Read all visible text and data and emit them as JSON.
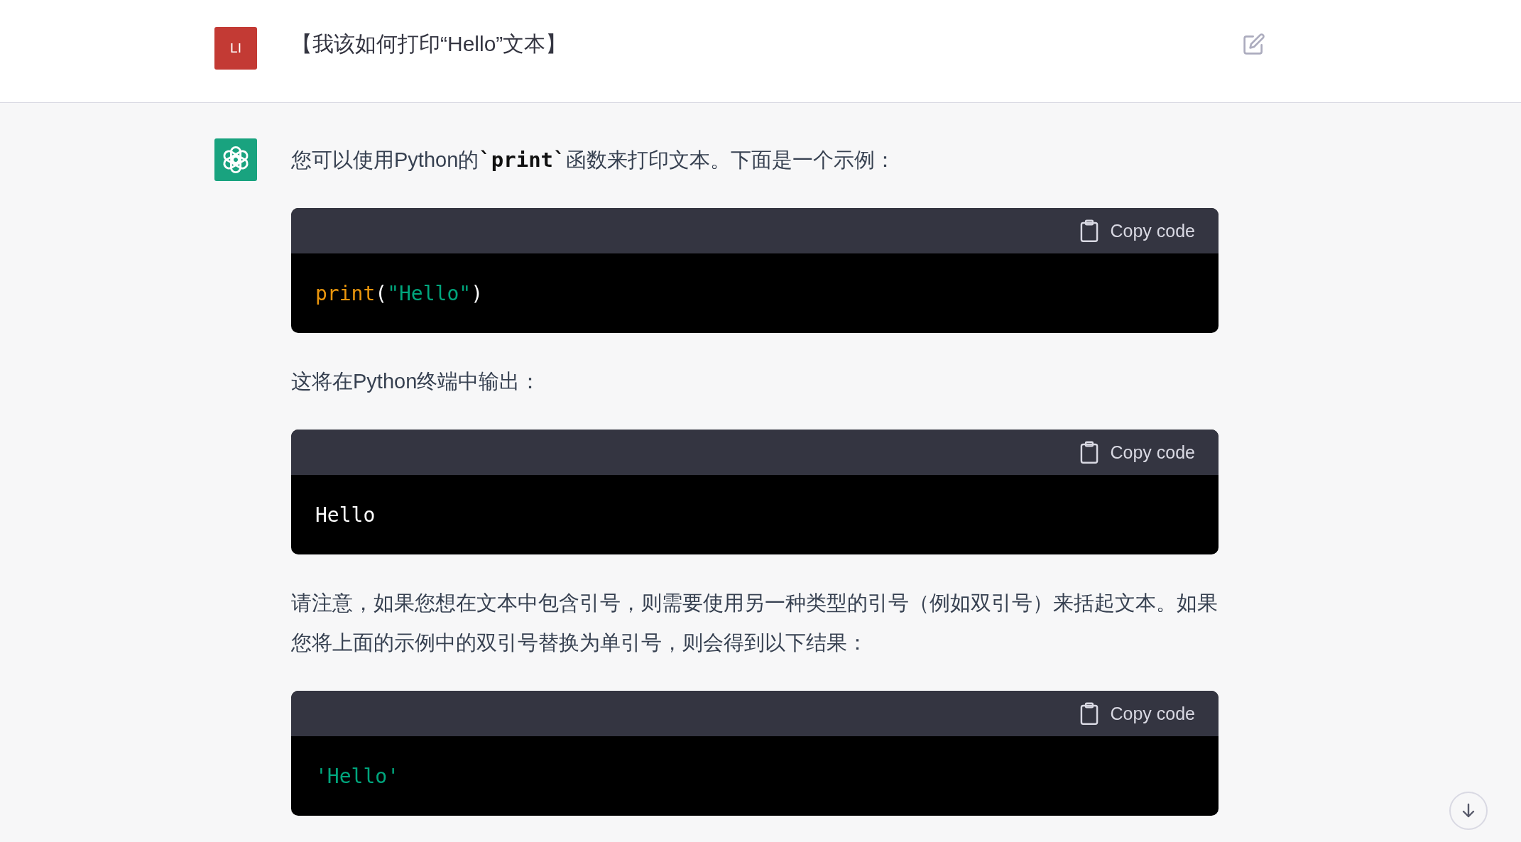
{
  "question": {
    "avatar_text": "LI",
    "text": "【我该如何打印“Hello”文本】"
  },
  "answer": {
    "blocks": [
      {
        "kind": "paragraph",
        "segments": [
          {
            "kind": "text",
            "text": "您可以使用Python的"
          },
          {
            "kind": "code",
            "text": "`print`"
          },
          {
            "kind": "text",
            "text": "函数来打印文本。下面是一个示例："
          }
        ]
      },
      {
        "kind": "code",
        "button": "Copy code",
        "tokens": [
          {
            "kind": "function",
            "text": "print"
          },
          {
            "kind": "plain",
            "text": "("
          },
          {
            "kind": "string",
            "text": "\"Hello\""
          },
          {
            "kind": "plain",
            "text": ")"
          }
        ]
      },
      {
        "kind": "paragraph",
        "segments": [
          {
            "kind": "text",
            "text": "这将在Python终端中输出："
          }
        ]
      },
      {
        "kind": "code",
        "button": "Copy code",
        "tokens": [
          {
            "kind": "plain",
            "text": "Hello"
          }
        ]
      },
      {
        "kind": "paragraph",
        "segments": [
          {
            "kind": "text",
            "text": "请注意，如果您想在文本中包含引号，则需要使用另一种类型的引号（例如双引号）来括起文本。如果您将上面的示例中的双引号替换为单引号，则会得到以下结果："
          }
        ]
      },
      {
        "kind": "code",
        "button": "Copy code",
        "tokens": [
          {
            "kind": "string",
            "text": "'Hello'"
          }
        ]
      }
    ]
  }
}
